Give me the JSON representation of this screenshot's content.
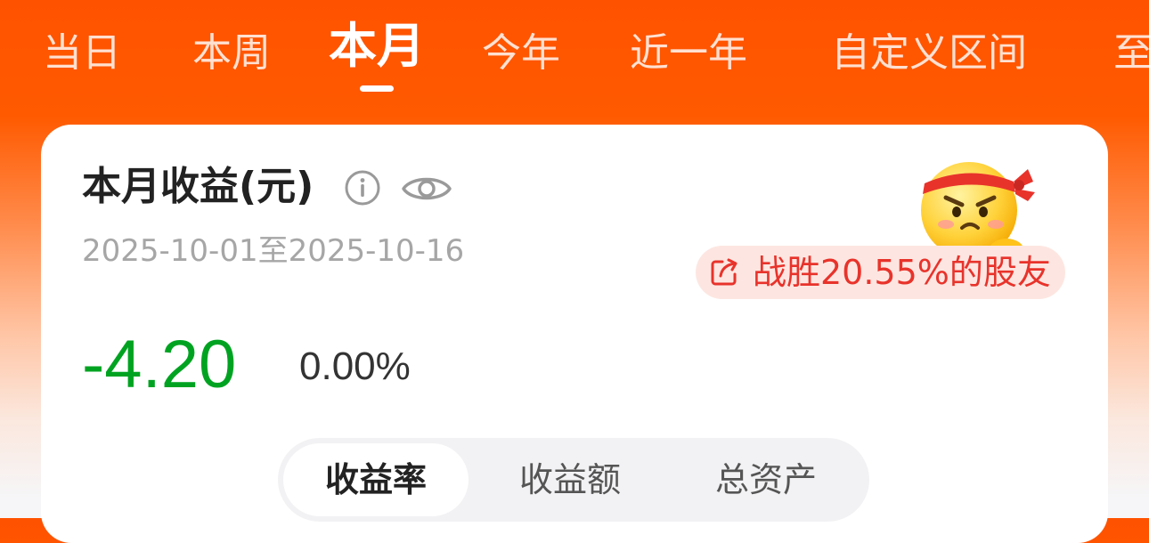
{
  "tabs": [
    {
      "label": "当日",
      "active": false
    },
    {
      "label": "本周",
      "active": false
    },
    {
      "label": "本月",
      "active": true
    },
    {
      "label": "今年",
      "active": false
    },
    {
      "label": "近一年",
      "active": false
    },
    {
      "label": "自定义区间",
      "active": false
    },
    {
      "label": "至",
      "active": false
    }
  ],
  "card": {
    "title": "本月收益(元)",
    "date_range": "2025-10-01至2025-10-16",
    "beat_text": "战胜20.55%的股友",
    "profit_value": "-4.20",
    "profit_rate": "0.00%"
  },
  "segment": {
    "items": [
      "收益率",
      "收益额",
      "总资产"
    ],
    "active_index": 0
  },
  "colors": {
    "header": "#ff5200",
    "loss_green": "#00a321",
    "badge_red": "#e8332b",
    "badge_bg": "#fde6e1"
  },
  "icons": {
    "info": "info-icon",
    "eye": "eye-icon",
    "share": "share-icon",
    "mascot": "mascot-icon"
  }
}
